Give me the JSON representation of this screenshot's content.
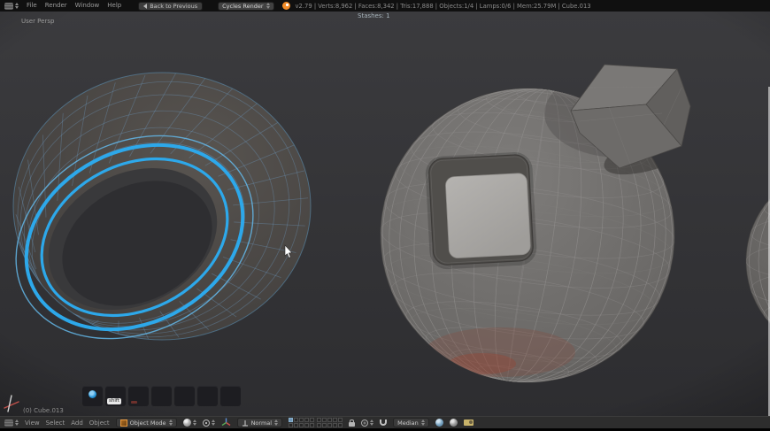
{
  "topbar": {
    "menus": [
      "File",
      "Render",
      "Window",
      "Help"
    ],
    "back_button_label": "Back to Previous",
    "render_engine": "Cycles Render",
    "stats": "v2.79 | Verts:8,962 | Faces:8,342 | Tris:17,888 | Objects:1/4 | Lamps:0/6 | Mem:25.79M | Cube.013"
  },
  "viewport": {
    "view_label": "User Persp",
    "overlay_counter": "Stashes: 1",
    "object_name_label": "(0) Cube.013",
    "screencast_key": "shift"
  },
  "bottombar": {
    "menus": [
      "View",
      "Select",
      "Add",
      "Object"
    ],
    "mode_selector": "Object Mode",
    "orientation_selector": "Normal",
    "snap_target_selector": "Median"
  },
  "colors": {
    "selection_blue": "#2da8ea",
    "wireframe_blue": "#6f9cc2",
    "viewport_bg": "#343437",
    "header_bg": "#2d2d2d",
    "topbar_bg": "#101010"
  }
}
